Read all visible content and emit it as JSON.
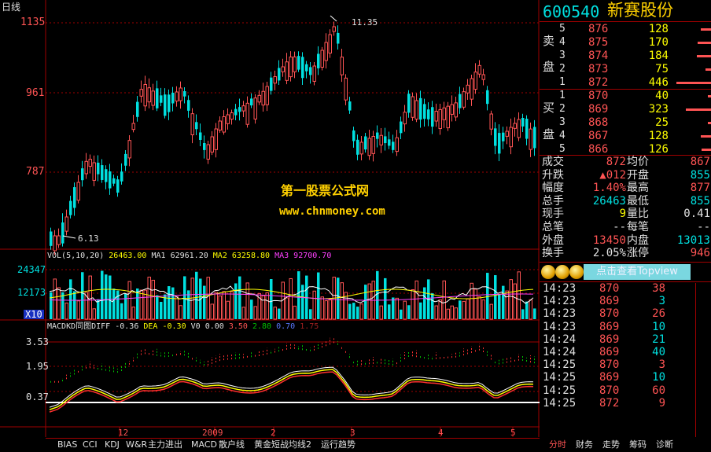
{
  "chart_header": {
    "period_label": "日线",
    "price_ticks": [
      "1135",
      "961",
      "787"
    ],
    "high_annotation": "11.35",
    "low_annotation": "6.13",
    "watermark_line1": "第一股票公式网",
    "watermark_line2": "www.chnmoney.com"
  },
  "volume_panel": {
    "legend_title": "VOL(5,10,20)",
    "vol_value": "26463.00",
    "ma1_label": "MA1",
    "ma1_value": "62961.20",
    "ma2_label": "MA2",
    "ma2_value": "63258.80",
    "ma3_label": "MA3",
    "ma3_value": "92700.70",
    "ticks": [
      "24347",
      "12173"
    ],
    "unit": "X10"
  },
  "macd_panel": {
    "title": "MACDKD同图",
    "diff_label": "DIFF",
    "diff_value": "-0.36",
    "dea_label": "DEA",
    "dea_value": "-0.30",
    "v0_label": "V0",
    "v0_value": "0.00",
    "v1": "3.50",
    "v2": "2.80",
    "v3": "0.70",
    "v4": "1.75",
    "ticks": [
      "3.53",
      "1.95",
      "0.37"
    ]
  },
  "x_axis": {
    "labels": [
      "12",
      "2009",
      "2",
      "3",
      "4",
      "5"
    ]
  },
  "bottom_tabs": [
    "BIAS",
    "CCI",
    "KDJ",
    "W&R",
    "主力进出",
    "MACD",
    "散户线",
    "黄金短战均线2",
    "运行趋势"
  ],
  "quote": {
    "code": "600540",
    "name": "新赛股份",
    "sell_side_label": [
      "卖",
      "盘"
    ],
    "buy_side_label": [
      "买",
      "盘"
    ],
    "sell": [
      {
        "level": "5",
        "price": "876",
        "volume": "128"
      },
      {
        "level": "4",
        "price": "875",
        "volume": "170"
      },
      {
        "level": "3",
        "price": "874",
        "volume": "184"
      },
      {
        "level": "2",
        "price": "873",
        "volume": "75"
      },
      {
        "level": "1",
        "price": "872",
        "volume": "446"
      }
    ],
    "buy": [
      {
        "level": "1",
        "price": "870",
        "volume": "40"
      },
      {
        "level": "2",
        "price": "869",
        "volume": "323"
      },
      {
        "level": "3",
        "price": "868",
        "volume": "25"
      },
      {
        "level": "4",
        "price": "867",
        "volume": "128"
      },
      {
        "level": "5",
        "price": "866",
        "volume": "126"
      }
    ],
    "stats": [
      {
        "l1": "成交",
        "v1": "872",
        "l2": "均价",
        "v2": "867",
        "c1": "red",
        "c2": "red"
      },
      {
        "l1": "升跌",
        "v1": "▲012",
        "l2": "开盘",
        "v2": "855",
        "c1": "red",
        "c2": "grn"
      },
      {
        "l1": "幅度",
        "v1": "1.40%",
        "l2": "最高",
        "v2": "877",
        "c1": "red",
        "c2": "red"
      },
      {
        "l1": "总手",
        "v1": "26463",
        "l2": "最低",
        "v2": "855",
        "c1": "grn",
        "c2": "grn"
      },
      {
        "l1": "现手",
        "v1": "9",
        "l2": "量比",
        "v2": "0.41",
        "c1": "yel",
        "c2": "wht"
      },
      {
        "l1": "总笔",
        "v1": "--",
        "l2": "每笔",
        "v2": "--",
        "c1": "wht",
        "c2": "wht"
      },
      {
        "l1": "外盘",
        "v1": "13450",
        "l2": "内盘",
        "v2": "13013",
        "c1": "red",
        "c2": "grn"
      },
      {
        "l1": "换手",
        "v1": "2.05%",
        "l2": "涨停",
        "v2": "946",
        "c1": "wht",
        "c2": "red"
      }
    ],
    "topview_button": "点击查看Topview",
    "ticks": [
      {
        "time": "14:23",
        "price": "870",
        "volume": "38",
        "pc": "red",
        "vc": "red"
      },
      {
        "time": "14:23",
        "price": "869",
        "volume": "3",
        "pc": "red",
        "vc": "grn"
      },
      {
        "time": "14:23",
        "price": "870",
        "volume": "26",
        "pc": "red",
        "vc": "red"
      },
      {
        "time": "14:23",
        "price": "869",
        "volume": "10",
        "pc": "red",
        "vc": "grn"
      },
      {
        "time": "14:24",
        "price": "869",
        "volume": "21",
        "pc": "red",
        "vc": "grn"
      },
      {
        "time": "14:24",
        "price": "869",
        "volume": "40",
        "pc": "red",
        "vc": "grn"
      },
      {
        "time": "14:25",
        "price": "870",
        "volume": "3",
        "pc": "red",
        "vc": "red"
      },
      {
        "time": "14:25",
        "price": "869",
        "volume": "10",
        "pc": "red",
        "vc": "grn"
      },
      {
        "time": "14:25",
        "price": "870",
        "volume": "60",
        "pc": "red",
        "vc": "red"
      },
      {
        "time": "14:25",
        "price": "872",
        "volume": "9",
        "pc": "red",
        "vc": "red"
      }
    ],
    "right_tabs": [
      "分时",
      "财务",
      "走势",
      "筹码",
      "诊断"
    ]
  },
  "colors": {
    "up": "#ff5454",
    "down": "#00e0e0",
    "grid": "#a00000",
    "ma_white": "#ffffff",
    "ma_yellow": "#ffff00",
    "ma_magenta": "#ff40ff"
  }
}
